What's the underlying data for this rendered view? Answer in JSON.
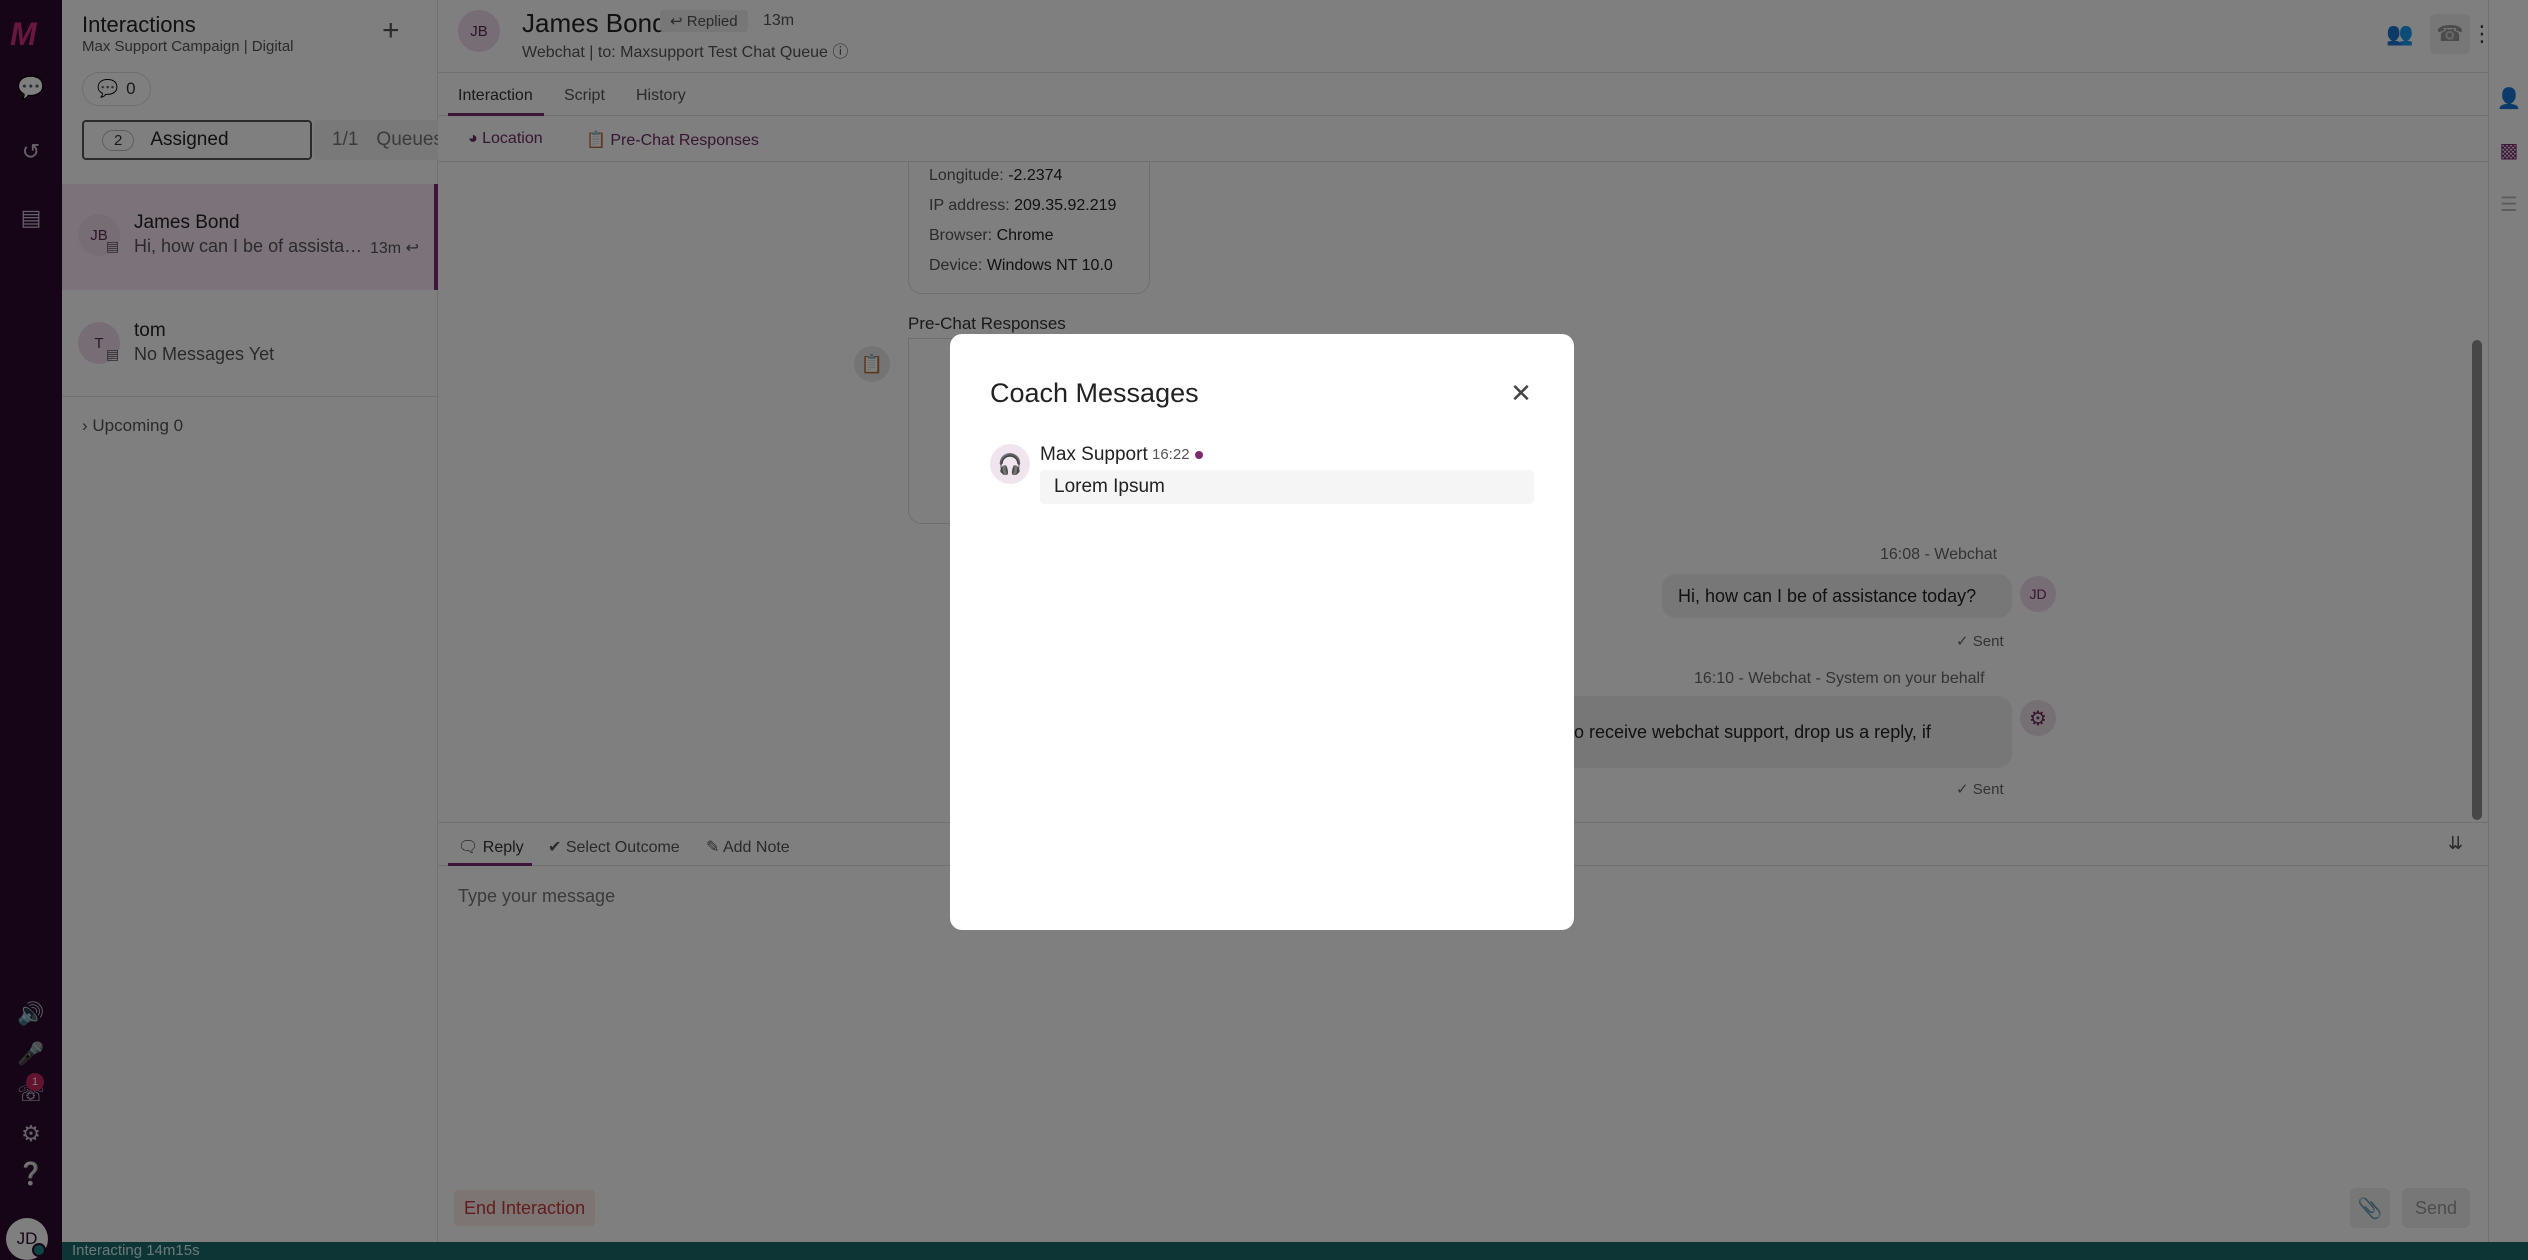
{
  "rail": {
    "logo": "M",
    "avatar": "JD",
    "badge": "1"
  },
  "panel": {
    "title": "Interactions",
    "subtitle": "Max Support Campaign | Digital",
    "message_count": "0",
    "assigned_count": "2",
    "assigned_label": "Assigned",
    "queues_count": "1/1",
    "queues_label": "Queues",
    "conversations": [
      {
        "initials": "JB",
        "name": "James Bond",
        "preview": "Hi, how can I be of assistance today?",
        "time": "13m"
      },
      {
        "initials": "T",
        "name": "tom",
        "preview": "No Messages Yet",
        "time": ""
      }
    ],
    "upcoming": "Upcoming 0"
  },
  "header": {
    "initials": "JB",
    "name": "James Bond",
    "badge": "Replied",
    "time": "13m",
    "subtitle": "Webchat  | to: Maxsupport Test Chat Queue"
  },
  "tabs": [
    "Interaction",
    "Script",
    "History"
  ],
  "subtabs": [
    "Location",
    "Pre-Chat Responses"
  ],
  "location": {
    "longitude_label": "Longitude:",
    "longitude": "-2.2374",
    "ip_label": "IP address:",
    "ip": "209.35.92.219",
    "browser_label": "Browser:",
    "browser": "Chrome",
    "device_label": "Device:",
    "device": "Windows NT 10.0"
  },
  "prechat_title": "Pre-Chat Responses",
  "messages": [
    {
      "meta": "16:08 - Webchat",
      "text": "Hi, how can I be of assistance today?",
      "status": "Sent",
      "avatar": "JD"
    },
    {
      "meta": "16:10 - Webchat - System on your behalf",
      "text": "e to receive webchat support, drop us a reply, if",
      "status": "Sent"
    }
  ],
  "reply": {
    "tabs": [
      "Reply",
      "Select Outcome",
      "Add Note"
    ],
    "placeholder": "Type your message",
    "end_label": "End Interaction",
    "send_label": "Send"
  },
  "status_bar": "Interacting 14m15s",
  "modal": {
    "title": "Coach Messages",
    "sender": "Max Support",
    "time": "16:22",
    "body": "Lorem Ipsum"
  },
  "colors": {
    "rail": "#2d0a2e",
    "accent": "#7b2a6f",
    "status": "#1a6b6b",
    "logo": "#d52f7e"
  }
}
